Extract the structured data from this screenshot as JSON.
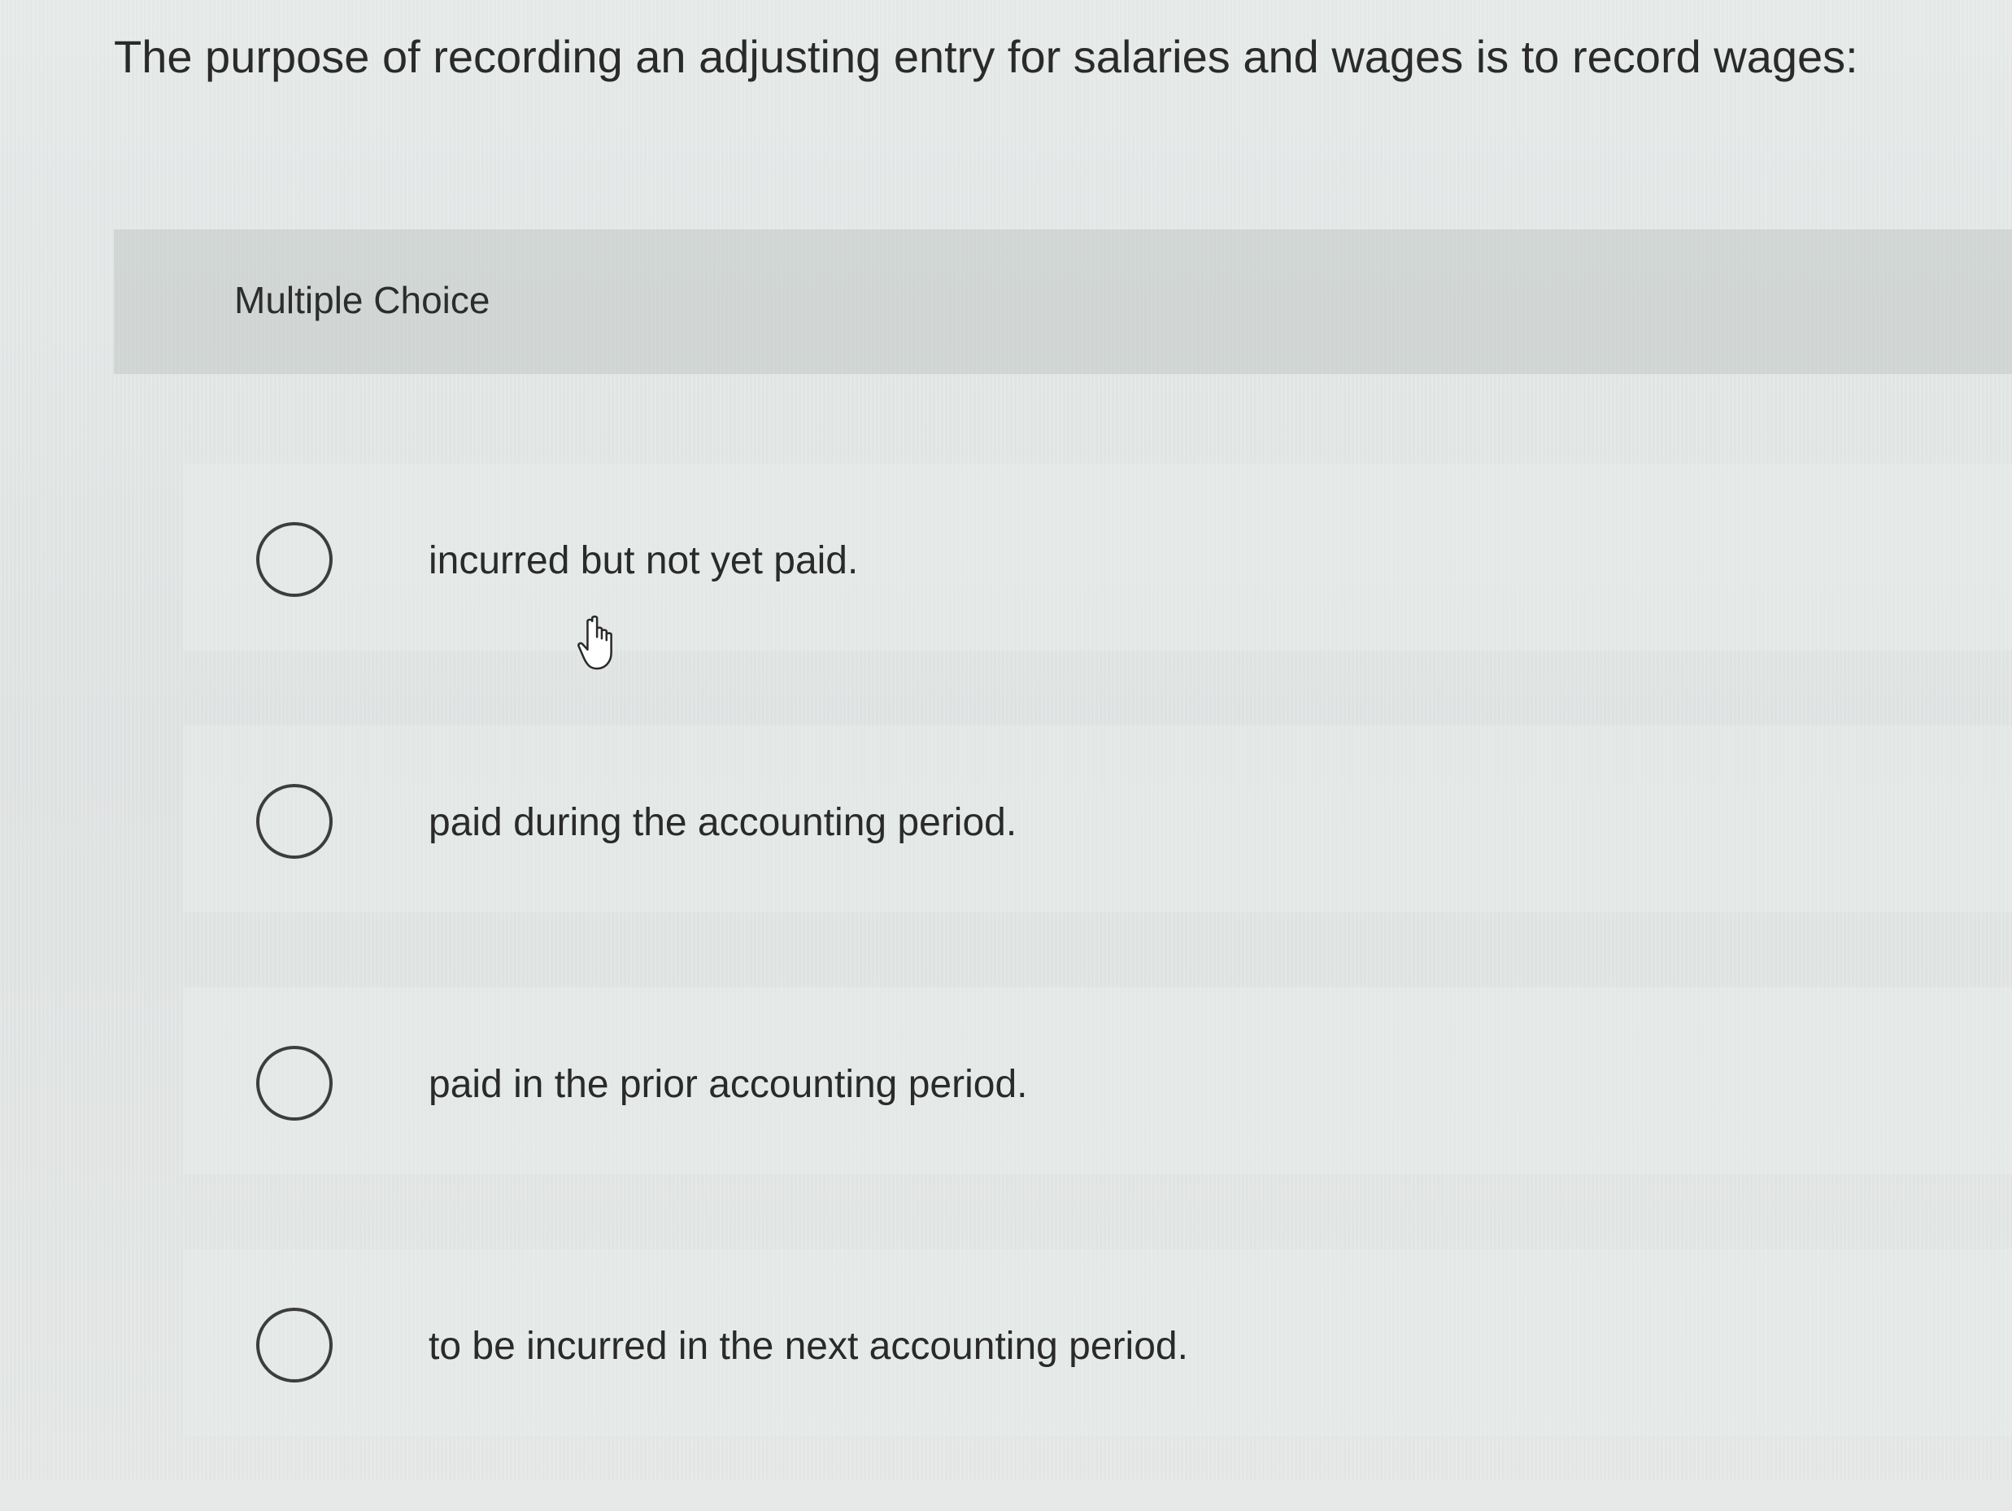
{
  "question": {
    "text": "The purpose of recording an adjusting entry for salaries and wages is to record wages:"
  },
  "multiple_choice": {
    "label": "Multiple Choice",
    "options": [
      {
        "text": "incurred but not yet paid.",
        "selected": false
      },
      {
        "text": "paid during the accounting period.",
        "selected": false
      },
      {
        "text": "paid in the prior accounting period.",
        "selected": false
      },
      {
        "text": "to be incurred in the next accounting period.",
        "selected": false
      }
    ]
  },
  "cursor": {
    "icon": "hand-pointer-icon"
  }
}
